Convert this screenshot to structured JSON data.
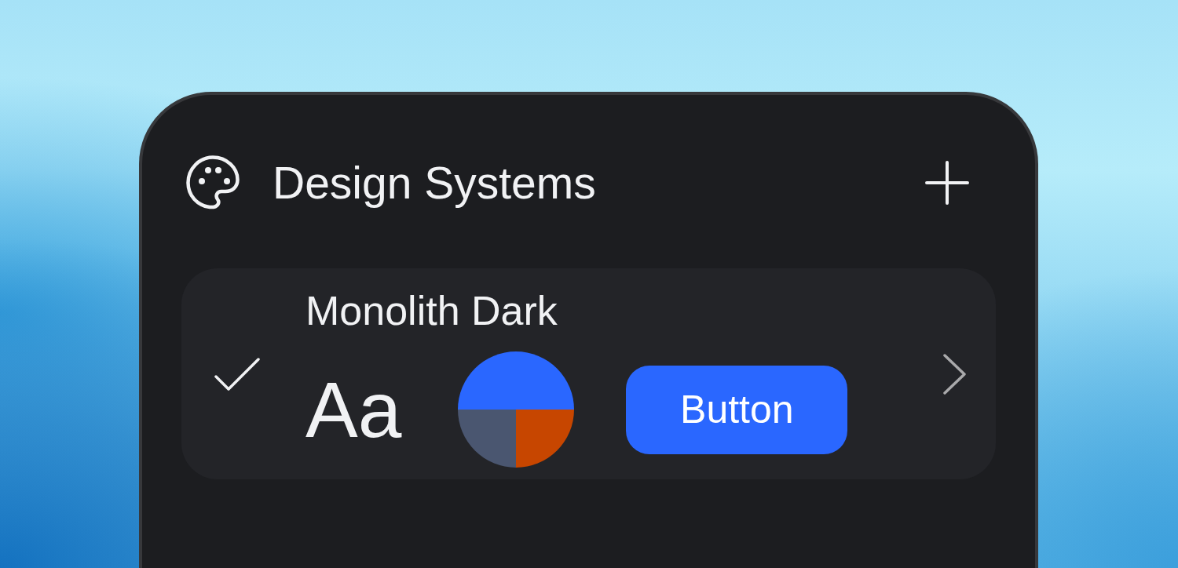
{
  "panel": {
    "title": "Design Systems"
  },
  "design_systems": [
    {
      "name": "Monolith Dark",
      "selected": true,
      "type_sample": "Aa",
      "palette": [
        {
          "color": "#2a67ff"
        },
        {
          "color": "#4a5670"
        },
        {
          "color": "#c74600"
        }
      ],
      "button_label": "Button"
    }
  ]
}
